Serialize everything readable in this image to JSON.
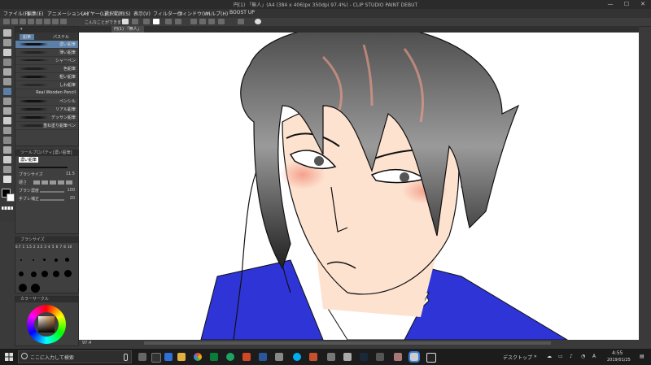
{
  "window": {
    "title": "円(1) 「無人」(A4 (384 x 406)px 350dpi 97.4%) - CLIP STUDIO PAINT DEBUT",
    "minimize": "—",
    "maximize": "☐",
    "close": "✕"
  },
  "menu": [
    "ファイル(F)",
    "編集(E)",
    "アニメーション(A)",
    "レイヤー(L)",
    "選択範囲(S)",
    "表示(V)",
    "フィルター(I)",
    "ウィンドウ(W)",
    "ヘルプ(H)",
    "BOOST UP"
  ],
  "cmdbar": {
    "hint": "こんなことができます"
  },
  "document_tab": "円(1) 「無人」",
  "brush_panel": {
    "tabs": [
      "鉛筆",
      "パステル"
    ],
    "brushes": [
      "濃い鉛筆",
      "薄い鉛筆",
      "シャーペン",
      "色鉛筆",
      "粗い鉛筆",
      "しわ鉛筆",
      "Real Wooden Pencil",
      "ペンシル",
      "リアル鉛筆",
      "デッサン鉛筆",
      "重ね塗り鉛筆ペン"
    ],
    "selected_index": 0
  },
  "tool_property": {
    "header": "ツールプロパティ[濃い鉛筆]",
    "brush_name": "濃い鉛筆",
    "rows": [
      {
        "label": "ブラシサイズ",
        "value": "11.5"
      },
      {
        "label": "硬さ",
        "value": ""
      },
      {
        "label": "ブラシ濃度",
        "value": "100"
      },
      {
        "label": "手ブレ補正",
        "value": "20"
      }
    ]
  },
  "brush_size_panel": {
    "header": "ブラシサイズ",
    "sizes": [
      "0.7",
      "1",
      "1.5",
      "2",
      "2.5",
      "3",
      "4",
      "5",
      "6",
      "7",
      "8",
      "10"
    ]
  },
  "color_panel": {
    "header": "カラーサークル"
  },
  "statusbar": {
    "zoom": "97.4"
  },
  "taskbar": {
    "search_placeholder": "ここに入力して検索",
    "tray_label": "デスクトップ",
    "ime": "A",
    "time": "4:55",
    "date": "2019/01/25"
  },
  "colors": {
    "hair_dark": "#2b2b2b",
    "hair_mid": "#8a8a8a",
    "skin": "#fde2cf",
    "blush": "#f6a08a",
    "jacket": "#2e34d6",
    "selected_brush": "#5b7fa6"
  }
}
